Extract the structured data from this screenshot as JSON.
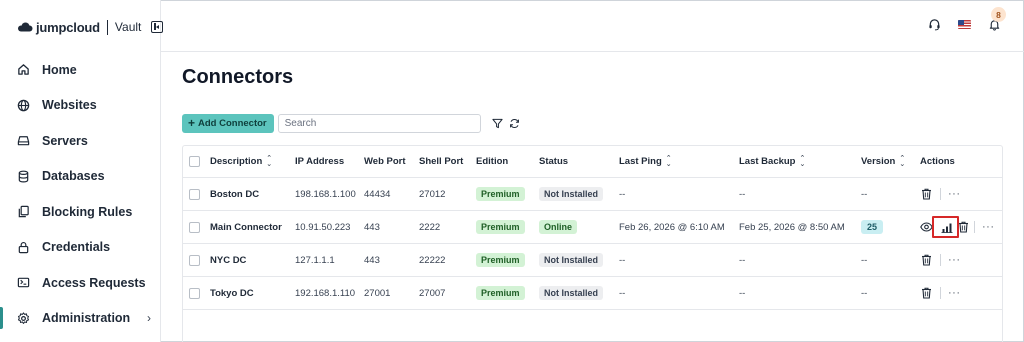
{
  "app": {
    "logo_text": "jumpcloud",
    "product": "Vault"
  },
  "colors": {
    "accent": "#5cc4bd",
    "active_indicator": "#2b8f8c",
    "highlight": "#d62828"
  },
  "sidebar": {
    "items": [
      {
        "label": "Home",
        "icon": "home-icon"
      },
      {
        "label": "Websites",
        "icon": "globe-icon"
      },
      {
        "label": "Servers",
        "icon": "server-icon"
      },
      {
        "label": "Databases",
        "icon": "database-icon"
      },
      {
        "label": "Blocking Rules",
        "icon": "blocking-rules-icon"
      },
      {
        "label": "Credentials",
        "icon": "lock-icon"
      },
      {
        "label": "Access Requests",
        "icon": "access-requests-icon"
      },
      {
        "label": "Administration",
        "icon": "gear-icon",
        "expandable": true,
        "active": true
      }
    ]
  },
  "topbar": {
    "notification_count": "8",
    "icons": [
      "headset-icon",
      "us-flag-icon",
      "bell-icon"
    ]
  },
  "page": {
    "title": "Connectors"
  },
  "toolbar": {
    "add_label": "Add Connector",
    "search_placeholder": "Search",
    "filter_icon": "filter-icon",
    "refresh_icon": "refresh-icon"
  },
  "table": {
    "headers": {
      "description": "Description",
      "ip": "IP Address",
      "web_port": "Web Port",
      "shell_port": "Shell Port",
      "edition": "Edition",
      "status": "Status",
      "last_ping": "Last Ping",
      "last_backup": "Last Backup",
      "version": "Version",
      "actions": "Actions"
    },
    "rows": [
      {
        "description": "Boston DC",
        "ip": "198.168.1.100",
        "web_port": "44434",
        "shell_port": "27012",
        "edition": "Premium",
        "status": "Not Installed",
        "last_ping": "--",
        "last_backup": "--",
        "version": "--"
      },
      {
        "description": "Main Connector",
        "ip": "10.91.50.223",
        "web_port": "443",
        "shell_port": "2222",
        "edition": "Premium",
        "status": "Online",
        "last_ping": "Feb 26, 2026 @ 6:10 AM",
        "last_backup": "Feb 25, 2026 @ 8:50 AM",
        "version": "25"
      },
      {
        "description": "NYC DC",
        "ip": "127.1.1.1",
        "web_port": "443",
        "shell_port": "22222",
        "edition": "Premium",
        "status": "Not Installed",
        "last_ping": "--",
        "last_backup": "--",
        "version": "--"
      },
      {
        "description": "Tokyo DC",
        "ip": "192.168.1.110",
        "web_port": "27001",
        "shell_port": "27007",
        "edition": "Premium",
        "status": "Not Installed",
        "last_ping": "--",
        "last_backup": "--",
        "version": "--"
      }
    ],
    "kebab": "···"
  }
}
